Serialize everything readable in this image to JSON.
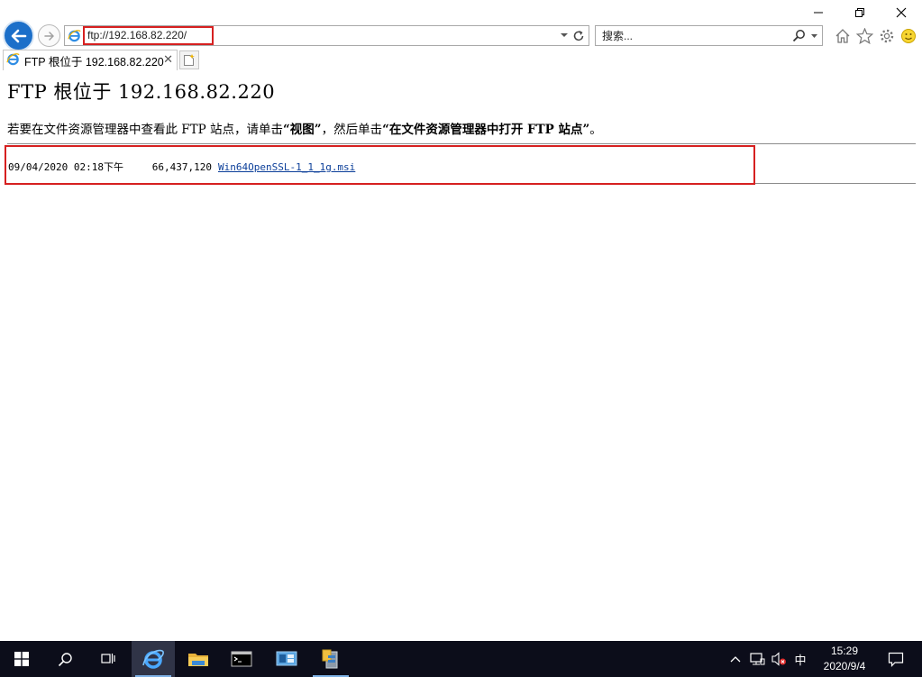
{
  "window": {
    "icons": [
      "minimize-icon",
      "restore-icon",
      "close-icon"
    ]
  },
  "address_bar": {
    "url": "ftp://192.168.82.220/"
  },
  "search": {
    "placeholder": "搜索..."
  },
  "toolbar_icons": [
    "home-icon",
    "favorites-star-icon",
    "settings-gear-icon",
    "smiley-feedback-icon"
  ],
  "tab": {
    "title": "FTP 根位于 192.168.82.220",
    "close": "✕"
  },
  "page": {
    "heading": "FTP 根位于 192.168.82.220",
    "instructions": {
      "part1": "若要在文件资源管理器中查看此 FTP 站点，请单击",
      "bold1": "“视图”",
      "part2": "，然后单击",
      "bold2": "“在文件资源管理器中打开 FTP 站点”",
      "part3": "。"
    },
    "listing": [
      {
        "date": "09/04/2020",
        "time": "02:18下午",
        "size": "66,437,120",
        "name": "Win64OpenSSL-1_1_1g.msi"
      }
    ]
  },
  "taskbar": {
    "apps": [
      "windows-start-icon",
      "search-icon",
      "task-view-icon",
      "internet-explorer-icon",
      "file-explorer-icon",
      "command-prompt-icon",
      "server-manager-icon",
      "setup-installer-icon"
    ],
    "tray": {
      "ime": "中",
      "time": "15:29",
      "date": "2020/9/4"
    }
  },
  "colors": {
    "highlight_red": "#d62020",
    "link": "#0b3e99",
    "taskbar": "#0c0d1a",
    "ie_blue": "#1c6fc9"
  }
}
